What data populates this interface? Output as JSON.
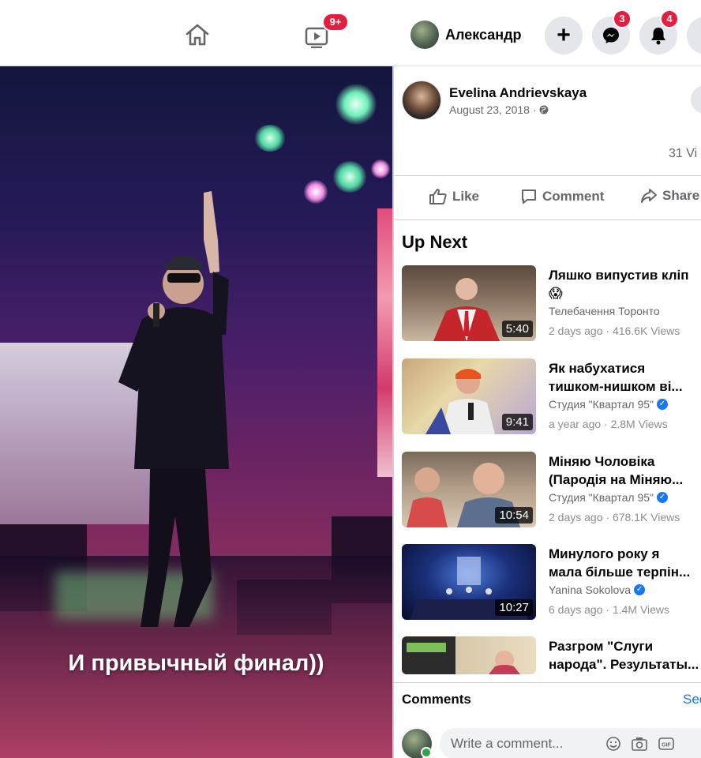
{
  "topbar": {
    "watch_badge": "9+",
    "profile_name": "Александр",
    "messenger_badge": "3",
    "notifications_badge": "4"
  },
  "video": {
    "caption": "И привычный финал))"
  },
  "post": {
    "author": "Evelina Andrievskaya",
    "date": "August 23, 2018 ·",
    "views": "31 Vi",
    "actions": {
      "like": "Like",
      "comment": "Comment",
      "share": "Share"
    }
  },
  "up_next": {
    "title": "Up Next",
    "items": [
      {
        "title_line1": "Ляшко випустив кліп",
        "title_line2": "😱",
        "channel": "Телебачення Торонто",
        "verified": false,
        "meta": "2 days ago · 416.6K Views",
        "duration": "5:40"
      },
      {
        "title_line1": "Як набухатися",
        "title_line2": "тишком-нишком ві...",
        "channel": "Студия \"Квартал 95\"",
        "verified": true,
        "meta": "a year ago · 2.8M Views",
        "duration": "9:41"
      },
      {
        "title_line1": "Міняю Чоловіка",
        "title_line2": "(Пародія на Міняю...",
        "channel": "Студия \"Квартал 95\"",
        "verified": true,
        "meta": "2 days ago · 678.1K Views",
        "duration": "10:54"
      },
      {
        "title_line1": "Минулого року я",
        "title_line2": "мала більше терпін...",
        "channel": "Yanina Sokolova",
        "verified": true,
        "meta": "6 days ago · 1.4M Views",
        "duration": "10:27"
      },
      {
        "title_line1": "Разгром \"Слуги",
        "title_line2": "народа\". Результаты...",
        "channel": "",
        "verified": false,
        "meta": "",
        "duration": ""
      }
    ]
  },
  "comments": {
    "label": "Comments",
    "see_all": "See",
    "placeholder": "Write a comment..."
  }
}
